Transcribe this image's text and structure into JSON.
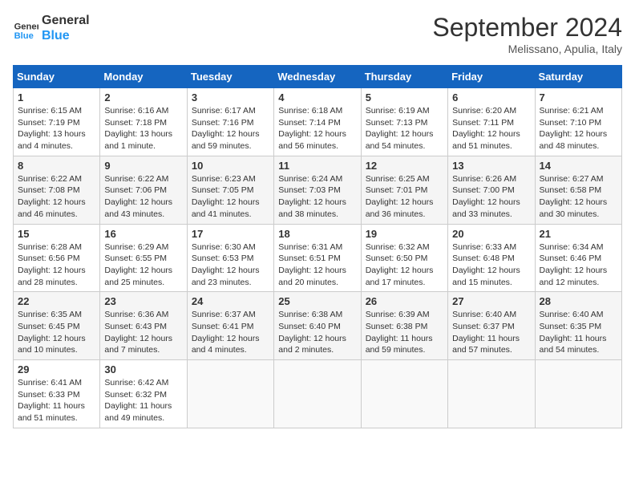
{
  "header": {
    "logo_line1": "General",
    "logo_line2": "Blue",
    "month_year": "September 2024",
    "location": "Melissano, Apulia, Italy"
  },
  "days_of_week": [
    "Sunday",
    "Monday",
    "Tuesday",
    "Wednesday",
    "Thursday",
    "Friday",
    "Saturday"
  ],
  "weeks": [
    [
      {
        "day": "1",
        "sunrise": "6:15 AM",
        "sunset": "7:19 PM",
        "daylight": "13 hours and 4 minutes."
      },
      {
        "day": "2",
        "sunrise": "6:16 AM",
        "sunset": "7:18 PM",
        "daylight": "13 hours and 1 minute."
      },
      {
        "day": "3",
        "sunrise": "6:17 AM",
        "sunset": "7:16 PM",
        "daylight": "12 hours and 59 minutes."
      },
      {
        "day": "4",
        "sunrise": "6:18 AM",
        "sunset": "7:14 PM",
        "daylight": "12 hours and 56 minutes."
      },
      {
        "day": "5",
        "sunrise": "6:19 AM",
        "sunset": "7:13 PM",
        "daylight": "12 hours and 54 minutes."
      },
      {
        "day": "6",
        "sunrise": "6:20 AM",
        "sunset": "7:11 PM",
        "daylight": "12 hours and 51 minutes."
      },
      {
        "day": "7",
        "sunrise": "6:21 AM",
        "sunset": "7:10 PM",
        "daylight": "12 hours and 48 minutes."
      }
    ],
    [
      {
        "day": "8",
        "sunrise": "6:22 AM",
        "sunset": "7:08 PM",
        "daylight": "12 hours and 46 minutes."
      },
      {
        "day": "9",
        "sunrise": "6:22 AM",
        "sunset": "7:06 PM",
        "daylight": "12 hours and 43 minutes."
      },
      {
        "day": "10",
        "sunrise": "6:23 AM",
        "sunset": "7:05 PM",
        "daylight": "12 hours and 41 minutes."
      },
      {
        "day": "11",
        "sunrise": "6:24 AM",
        "sunset": "7:03 PM",
        "daylight": "12 hours and 38 minutes."
      },
      {
        "day": "12",
        "sunrise": "6:25 AM",
        "sunset": "7:01 PM",
        "daylight": "12 hours and 36 minutes."
      },
      {
        "day": "13",
        "sunrise": "6:26 AM",
        "sunset": "7:00 PM",
        "daylight": "12 hours and 33 minutes."
      },
      {
        "day": "14",
        "sunrise": "6:27 AM",
        "sunset": "6:58 PM",
        "daylight": "12 hours and 30 minutes."
      }
    ],
    [
      {
        "day": "15",
        "sunrise": "6:28 AM",
        "sunset": "6:56 PM",
        "daylight": "12 hours and 28 minutes."
      },
      {
        "day": "16",
        "sunrise": "6:29 AM",
        "sunset": "6:55 PM",
        "daylight": "12 hours and 25 minutes."
      },
      {
        "day": "17",
        "sunrise": "6:30 AM",
        "sunset": "6:53 PM",
        "daylight": "12 hours and 23 minutes."
      },
      {
        "day": "18",
        "sunrise": "6:31 AM",
        "sunset": "6:51 PM",
        "daylight": "12 hours and 20 minutes."
      },
      {
        "day": "19",
        "sunrise": "6:32 AM",
        "sunset": "6:50 PM",
        "daylight": "12 hours and 17 minutes."
      },
      {
        "day": "20",
        "sunrise": "6:33 AM",
        "sunset": "6:48 PM",
        "daylight": "12 hours and 15 minutes."
      },
      {
        "day": "21",
        "sunrise": "6:34 AM",
        "sunset": "6:46 PM",
        "daylight": "12 hours and 12 minutes."
      }
    ],
    [
      {
        "day": "22",
        "sunrise": "6:35 AM",
        "sunset": "6:45 PM",
        "daylight": "12 hours and 10 minutes."
      },
      {
        "day": "23",
        "sunrise": "6:36 AM",
        "sunset": "6:43 PM",
        "daylight": "12 hours and 7 minutes."
      },
      {
        "day": "24",
        "sunrise": "6:37 AM",
        "sunset": "6:41 PM",
        "daylight": "12 hours and 4 minutes."
      },
      {
        "day": "25",
        "sunrise": "6:38 AM",
        "sunset": "6:40 PM",
        "daylight": "12 hours and 2 minutes."
      },
      {
        "day": "26",
        "sunrise": "6:39 AM",
        "sunset": "6:38 PM",
        "daylight": "11 hours and 59 minutes."
      },
      {
        "day": "27",
        "sunrise": "6:40 AM",
        "sunset": "6:37 PM",
        "daylight": "11 hours and 57 minutes."
      },
      {
        "day": "28",
        "sunrise": "6:40 AM",
        "sunset": "6:35 PM",
        "daylight": "11 hours and 54 minutes."
      }
    ],
    [
      {
        "day": "29",
        "sunrise": "6:41 AM",
        "sunset": "6:33 PM",
        "daylight": "11 hours and 51 minutes."
      },
      {
        "day": "30",
        "sunrise": "6:42 AM",
        "sunset": "6:32 PM",
        "daylight": "11 hours and 49 minutes."
      },
      null,
      null,
      null,
      null,
      null
    ]
  ]
}
